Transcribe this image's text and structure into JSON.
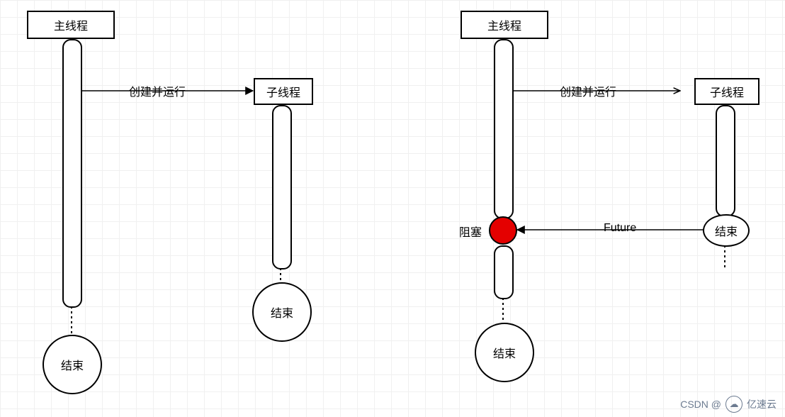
{
  "left": {
    "main_label": "主线程",
    "child_label": "子线程",
    "create_run": "创建并运行",
    "end_main": "结束",
    "end_child": "结束"
  },
  "right": {
    "main_label": "主线程",
    "child_label": "子线程",
    "create_run": "创建并运行",
    "future": "Future",
    "block": "阻塞",
    "end_main": "结束",
    "end_child": "结束"
  },
  "watermark": {
    "csdn": "CSDN @",
    "brand": "亿速云"
  }
}
